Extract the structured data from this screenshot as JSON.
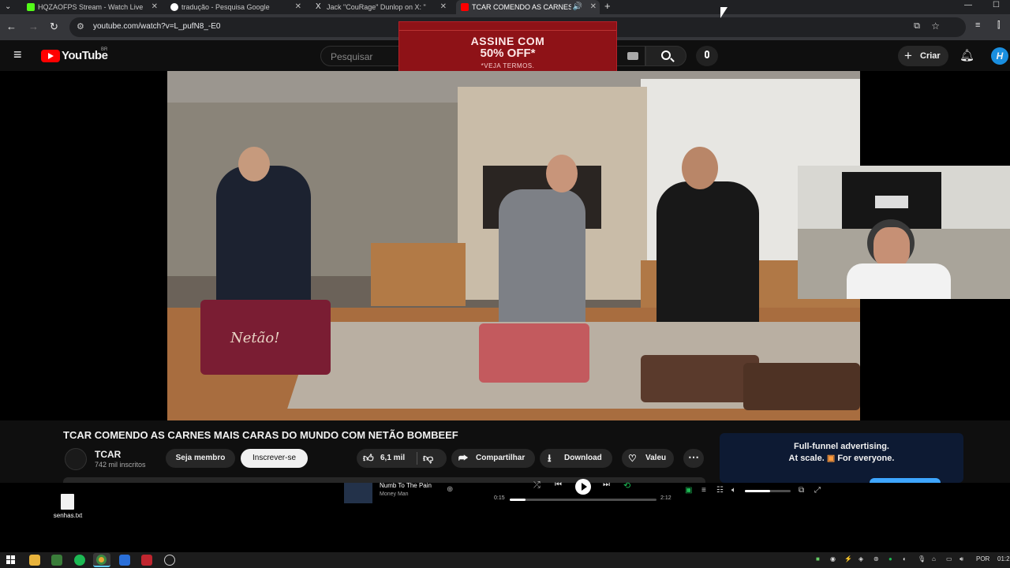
{
  "browser": {
    "tabs": [
      {
        "title": "HQZAOFPS Stream - Watch Live",
        "icon_color": "#53fc18"
      },
      {
        "title": "tradução - Pesquisa Google",
        "icon_color": "#ffffff"
      },
      {
        "title": "Jack \"CouRage\" Dunlop on X: \"",
        "icon_color": "#e7e9ea"
      },
      {
        "title": "TCAR COMENDO AS CARNES",
        "icon_color": "#ff0000"
      }
    ],
    "new_tab_symbol": "+",
    "url": "youtube.com/watch?v=L_pufN8_-E0"
  },
  "youtube": {
    "logo_text": "YouTube",
    "region": "BR",
    "search_placeholder": "Pesquisar",
    "create_label": "Criar",
    "avatar_letter": "H"
  },
  "ad_banner": {
    "headline_1": "ASSINE COM",
    "headline_2": "50% OFF*",
    "subtext": "*VEJA TERMOS."
  },
  "video": {
    "title": "TCAR COMENDO AS CARNES MAIS CARAS DO MUNDO COM NETÃO BOMBEEF",
    "channel_name": "TCAR",
    "subscribers": "742 mil inscritos",
    "member_label": "Seja membro",
    "subscribe_label": "Inscrever-se",
    "likes": "6,1 mil",
    "share_label": "Compartilhar",
    "download_label": "Download",
    "thanks_label": "Valeu",
    "bag_text": "Netão!"
  },
  "side_ad": {
    "line1": "Full-funnel advertising.",
    "line2": "At scale.",
    "line3": "For everyone."
  },
  "desktop": {
    "file_label": "senhas.txt"
  },
  "spotify": {
    "track": "Numb To The Pain",
    "artist": "Money Man",
    "elapsed": "0:15",
    "duration": "2:12",
    "progress": 0.11,
    "volume": 0.55
  },
  "taskbar": {
    "language": "POR",
    "clock": "01:2"
  },
  "colors": {
    "youtube_red": "#ff0000",
    "spotify_green": "#1db954",
    "ad_red": "#8e1217"
  }
}
